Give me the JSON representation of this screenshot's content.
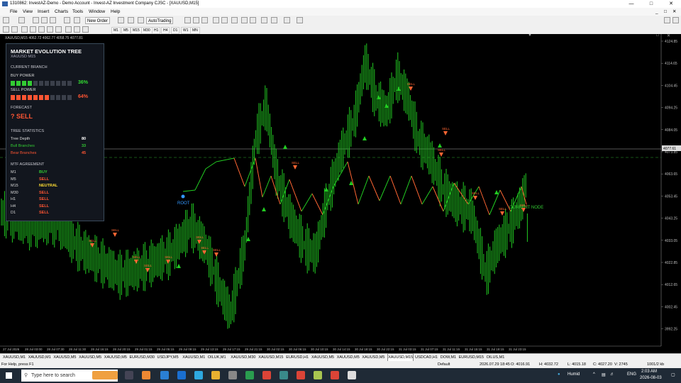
{
  "window": {
    "title": "1310862: InvestAZ-Demo - Demo Account - Invest-AZ Investment Company CJSC - [XAUUSD,M15]"
  },
  "menu": [
    "File",
    "View",
    "Insert",
    "Charts",
    "Tools",
    "Window",
    "Help"
  ],
  "toolbar": {
    "new_order": "New Order",
    "auto_trading": "AutoTrading"
  },
  "periods": [
    "M1",
    "M5",
    "M15",
    "M30",
    "H1",
    "H4",
    "D1",
    "W1",
    "MN"
  ],
  "chart": {
    "header": "XAUUSD,M15  4062.72 4062.77 4058.75 4077.81",
    "current_price": "4077.61",
    "price_ticks": [
      "4124.85",
      "4114.65",
      "4104.45",
      "4094.25",
      "4084.05",
      "4073.85",
      "4063.65",
      "4053.45",
      "4043.25",
      "4033.05",
      "4022.85",
      "4012.65",
      "4002.45",
      "3992.25"
    ],
    "time_ticks": [
      "27 Jul 2026",
      "28 Jul 03:00",
      "28 Jul 07:30",
      "28 Jul 11:30",
      "28 Jul 16:15",
      "28 Jul 20:15",
      "29 Jul 01:15",
      "29 Jul 05:15",
      "29 Jul 09:15",
      "29 Jul 13:15",
      "29 Jul 17:15",
      "29 Jul 21:15",
      "30 Jul 02:15",
      "30 Jul 06:15",
      "30 Jul 10:15",
      "30 Jul 14:15",
      "30 Jul 18:15",
      "30 Jul 22:15",
      "31 Jul 03:15",
      "31 Jul 07:15",
      "31 Jul 11:15",
      "31 Jul 15:15",
      "31 Jul 19:15",
      "31 Jul 23:15"
    ],
    "root_label": "ROOT",
    "current_node_label": "CURRENT NODE",
    "sell_label": "SELL",
    "colors": {
      "bull": "#22cc22",
      "bear": "#ff6633",
      "bg": "#000000"
    }
  },
  "panel": {
    "title": "MARKET EVOLUTION TREE",
    "subtitle": "XAUUSD M15",
    "current_branch": "CURRENT BRANCH",
    "buy_power_label": "BUY POWER",
    "buy_power": "36%",
    "buy_fraction": 0.36,
    "sell_power_label": "SELL POWER",
    "sell_power": "64%",
    "sell_fraction": 0.64,
    "forecast_label": "FORECAST",
    "forecast": "? SELL",
    "tree_stats_label": "TREE STATISTICS",
    "tree_depth_label": "Tree Depth",
    "tree_depth": "80",
    "bull_branches_label": "Bull Branches",
    "bull_branches": "33",
    "bear_branches_label": "Bear Branches",
    "bear_branches": "45",
    "mtf_label": "MTF AGREEMENT",
    "mtf": [
      {
        "tf": "M1",
        "signal": "BUY"
      },
      {
        "tf": "M5",
        "signal": "SELL"
      },
      {
        "tf": "M15",
        "signal": "NEUTRAL"
      },
      {
        "tf": "M30",
        "signal": "SELL"
      },
      {
        "tf": "H1",
        "signal": "SELL"
      },
      {
        "tf": "H4",
        "signal": "SELL"
      },
      {
        "tf": "D1",
        "signal": "SELL"
      }
    ]
  },
  "tabs": [
    "XAUUSD,M1",
    "XAUUSD,M1",
    "XAUUSD,M5",
    "XAUUSD,M5",
    "XAUUSD,M5",
    "EURUSD,M30",
    "USDJPY,M5",
    "XAUUSD,M1",
    "OILUK,M1",
    "XAUUSD,M30",
    "XAUUSD,M15",
    "EURUSD,H1",
    "XAUUSD,M5",
    "XAUUSD,M5",
    "XAUUSD,M5",
    "XAUUSD,M15",
    "USDCAD,H1",
    "DOW,M1",
    "EURUSD,M15",
    "OILUS,M1"
  ],
  "active_tab_index": 15,
  "status": {
    "help": "For Help, press F1",
    "profile": "Default",
    "datetime": "2026.07.29 18:45",
    "open": "O: 4016.91",
    "high": "H: 4032.72",
    "low": "L: 4015.18",
    "close": "C: 4027.20",
    "volume": "V: 2745",
    "traffic": "1001/2 kb"
  },
  "taskbar": {
    "search_placeholder": "Type here to search",
    "weather": "Humid",
    "lang": "ENG",
    "time": "2:03 AM",
    "date": "2026-08-03"
  }
}
